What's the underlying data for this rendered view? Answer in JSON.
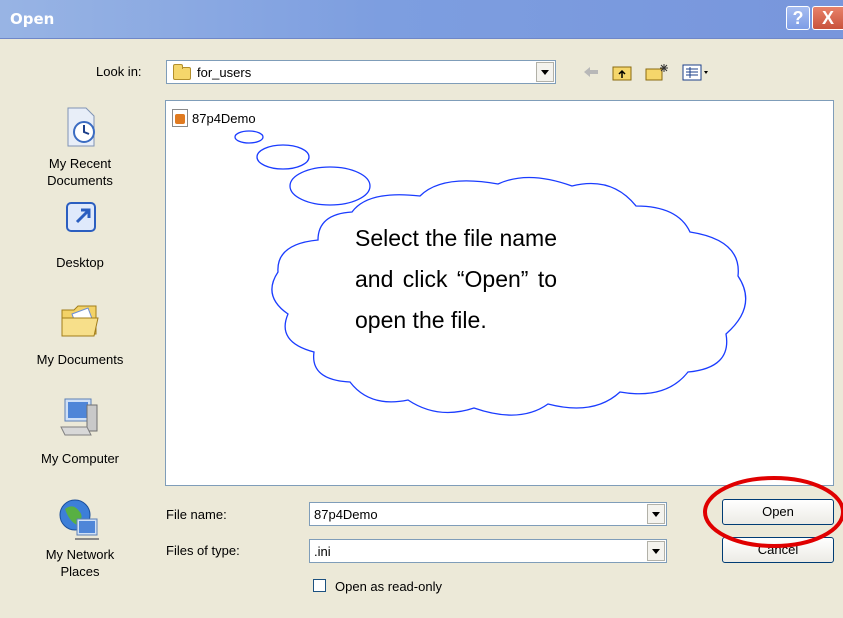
{
  "window": {
    "title": "Open"
  },
  "titlebar": {
    "help_glyph": "?",
    "close_glyph": "X"
  },
  "lookin": {
    "label": "Look in:",
    "value": "for_users"
  },
  "places": [
    {
      "label": "My Recent Documents",
      "icon": "recent-documents-icon"
    },
    {
      "label": "Desktop",
      "icon": "desktop-icon"
    },
    {
      "label": "My Documents",
      "icon": "my-documents-icon"
    },
    {
      "label": "My Computer",
      "icon": "my-computer-icon"
    },
    {
      "label": "My Network Places",
      "icon": "network-places-icon"
    }
  ],
  "files": [
    {
      "name": "87p4Demo",
      "icon": "file-icon"
    }
  ],
  "filename": {
    "label": "File name:",
    "value": "87p4Demo"
  },
  "filetype": {
    "label": "Files of type:",
    "value": ".ini"
  },
  "readonly": {
    "label": "Open as read-only",
    "checked": false
  },
  "buttons": {
    "open": "Open",
    "cancel": "Cancel"
  },
  "callout": {
    "line1": "Select the file name",
    "line2": "and click “Open” to",
    "line3": "open the file."
  },
  "colors": {
    "titlebar": "#7d9ee0",
    "dialog": "#ece9d8",
    "highlight": "#e00000",
    "callout_stroke": "#1a3cff"
  }
}
